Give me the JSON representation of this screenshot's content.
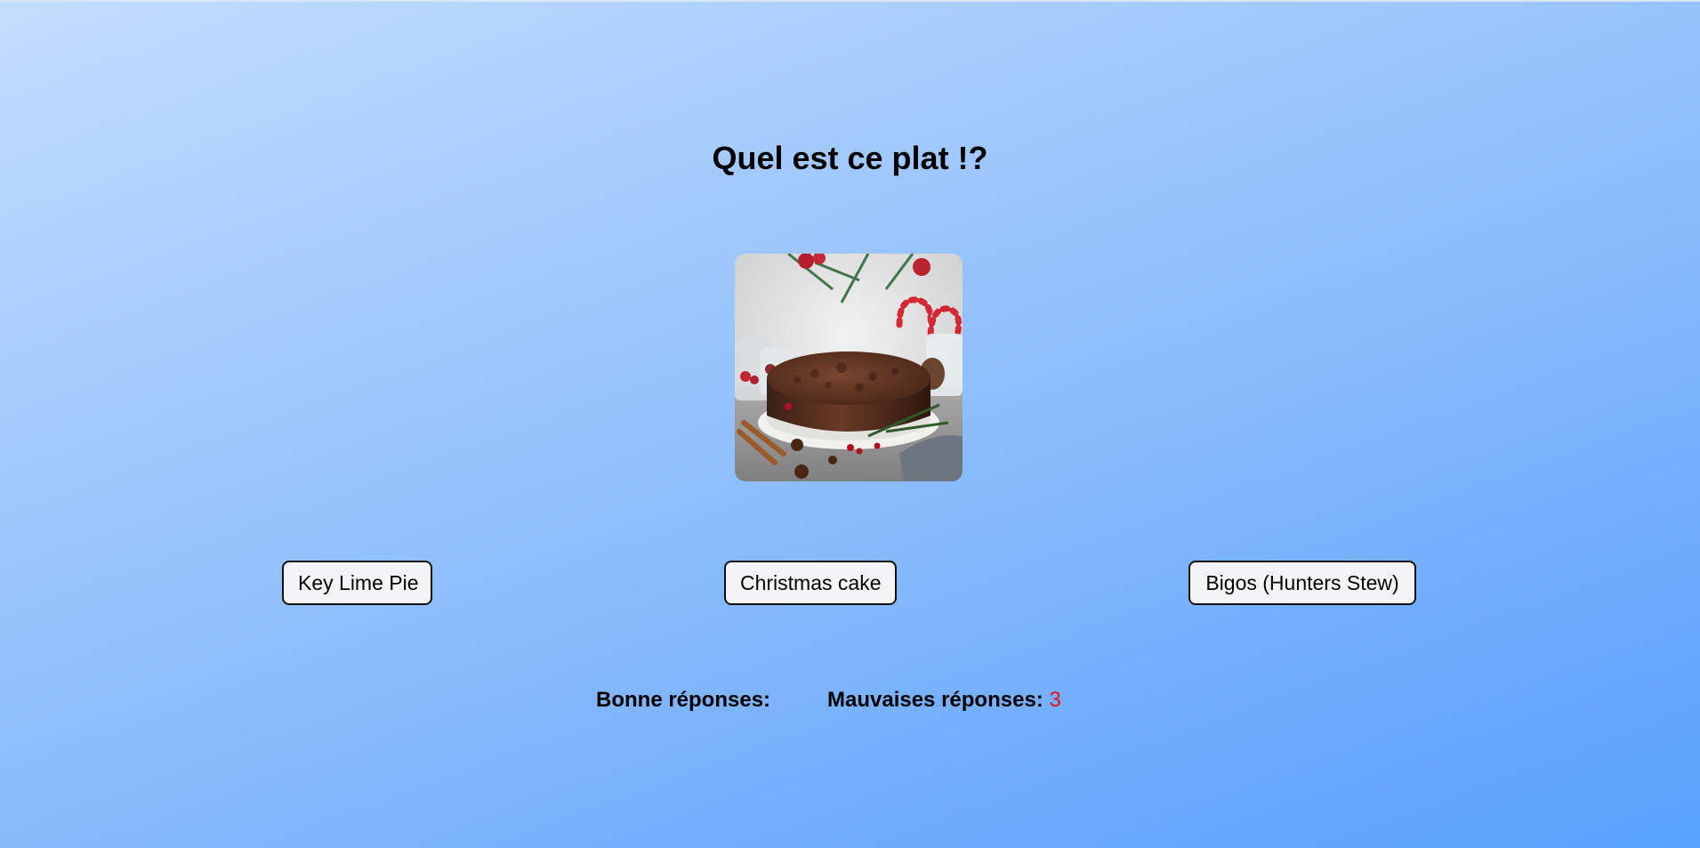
{
  "quiz": {
    "title": "Quel est ce plat !?",
    "answers": [
      "Key Lime Pie",
      "Christmas cake",
      "Bigos (Hunters Stew)"
    ]
  },
  "scores": {
    "good_label": "Bonne réponses:",
    "good_value": "",
    "bad_label": "Mauvaises réponses:",
    "bad_value": "3",
    "bad_color": "#e8101c"
  }
}
